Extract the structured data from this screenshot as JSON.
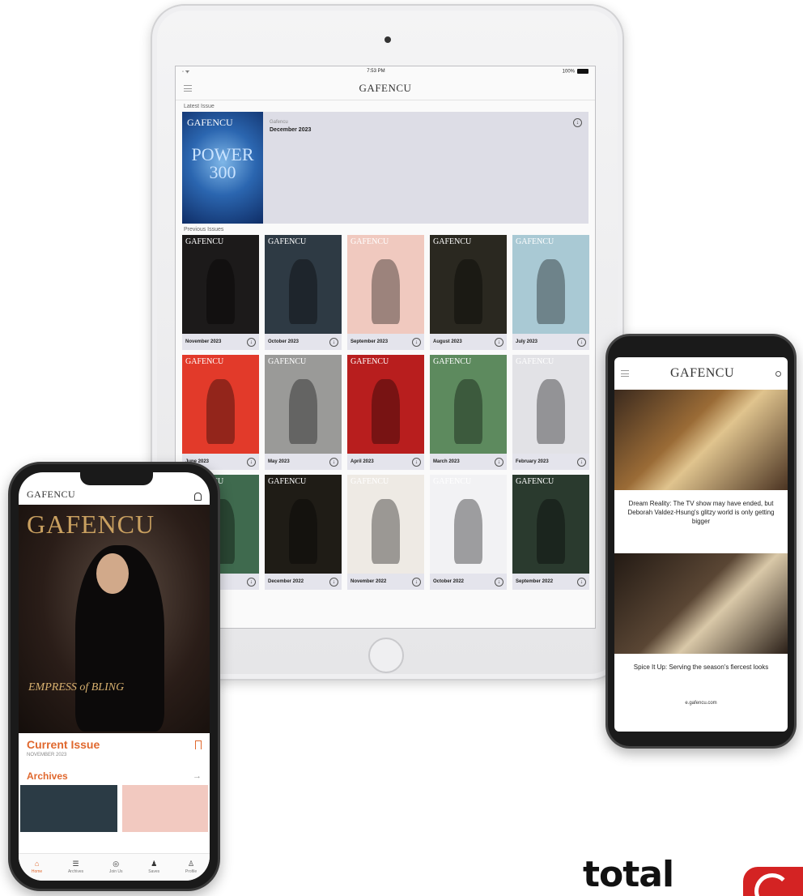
{
  "ipad": {
    "status_time": "7:53 PM",
    "status_battery": "100%",
    "logo": "GAFENCU",
    "latest_label": "Latest Issue",
    "latest": {
      "kicker": "Gafencu",
      "title": "December 2023",
      "cover_logo": "GAFENCU",
      "cover_text": "POWER 300",
      "cover_color": "#2b66b0"
    },
    "previous_label": "Previous Issues",
    "issues": [
      {
        "label": "November 2023",
        "color": "#1c1a1a"
      },
      {
        "label": "October 2023",
        "color": "#2e3a44"
      },
      {
        "label": "September 2023",
        "color": "#f0c9bf"
      },
      {
        "label": "August 2023",
        "color": "#2a2820"
      },
      {
        "label": "July 2023",
        "color": "#a9c9d4"
      },
      {
        "label": "June 2023",
        "color": "#e23a2a"
      },
      {
        "label": "May 2023",
        "color": "#9a9a98"
      },
      {
        "label": "April 2023",
        "color": "#b81e1e"
      },
      {
        "label": "March 2023",
        "color": "#5d8a5e"
      },
      {
        "label": "February 2023",
        "color": "#e2e2e6"
      },
      {
        "label": "January 2023",
        "color": "#3f6a4e"
      },
      {
        "label": "December 2022",
        "color": "#1f1c16"
      },
      {
        "label": "November 2022",
        "color": "#eeeae4"
      },
      {
        "label": "October 2022",
        "color": "#f2f2f4"
      },
      {
        "label": "September 2022",
        "color": "#2a3a2e"
      }
    ]
  },
  "iphone": {
    "logo": "GAFENCU",
    "hero_logo": "GAFENCU",
    "hero_text": "EMPRESS of BLING",
    "current_issue": "Current Issue",
    "current_sub": "NOVEMBER 2023",
    "archives": "Archives",
    "archive_colors": [
      "#2b3b45",
      "#f2c9c0"
    ],
    "tabs": [
      {
        "label": "Home",
        "icon": "⌂"
      },
      {
        "label": "Archives",
        "icon": "☰"
      },
      {
        "label": "Join Us",
        "icon": "◎"
      },
      {
        "label": "Saves",
        "icon": "♟"
      },
      {
        "label": "Profile",
        "icon": "♙"
      }
    ]
  },
  "android": {
    "logo": "GAFENCU",
    "article1": "Dream Reality: The TV show may have ended, but Deborah Valdez-Hsung's glitzy world is only getting bigger",
    "article2": "Spice It Up: Serving the season's fiercest looks",
    "url": "e.gafencu.com"
  },
  "brand": {
    "total": "total",
    "accent": "#d42323"
  }
}
